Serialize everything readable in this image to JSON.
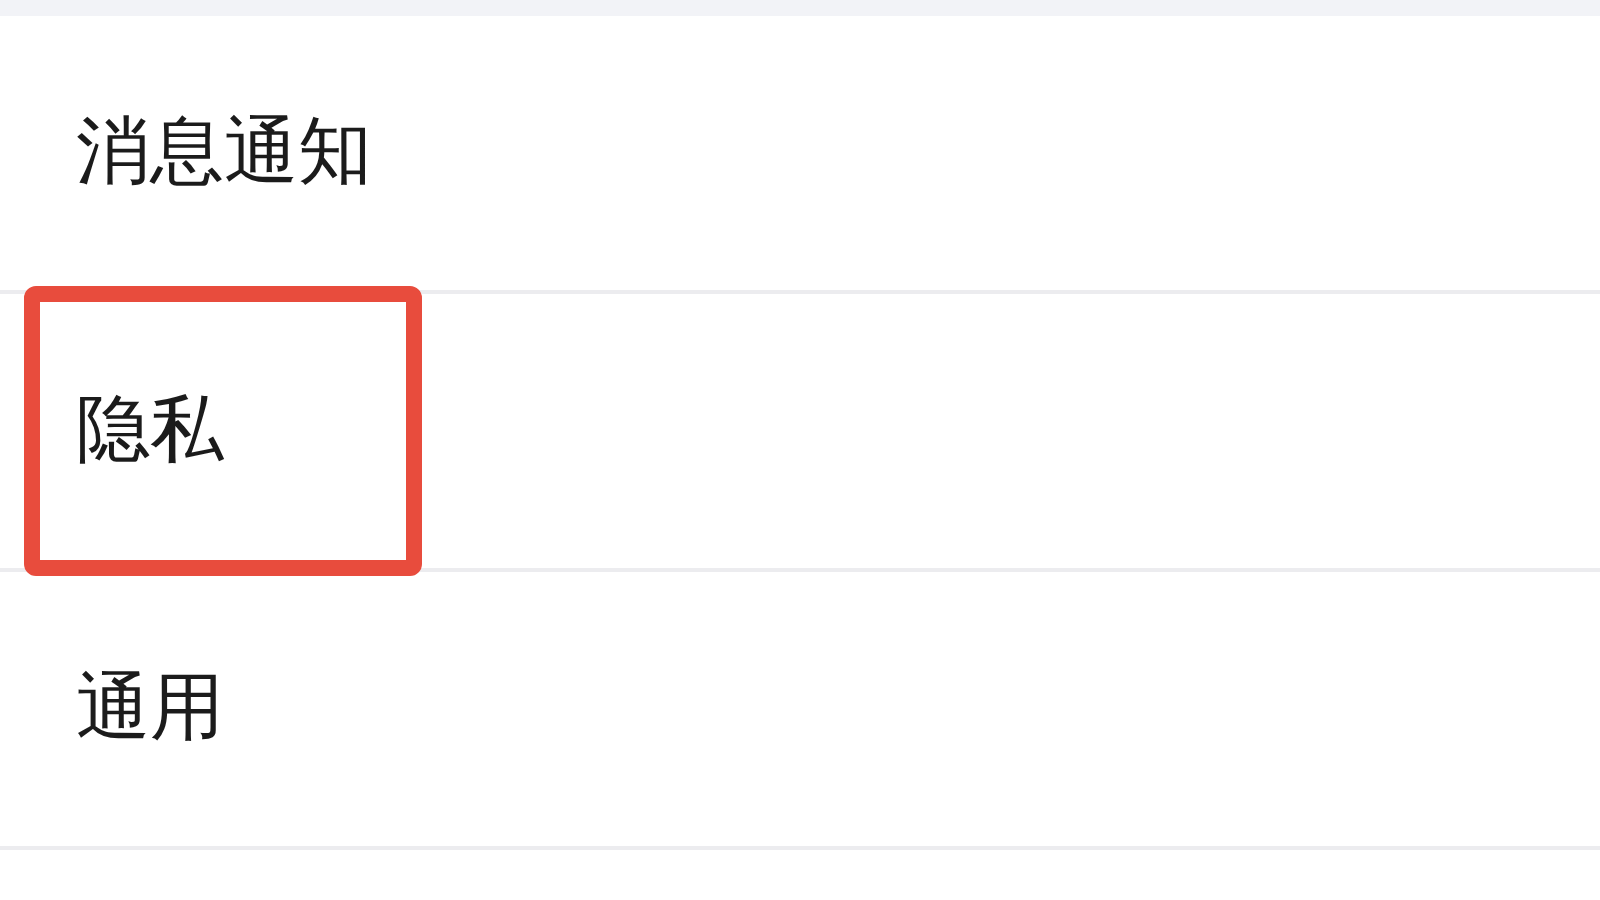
{
  "settings_items": [
    {
      "label": "消息通知",
      "highlighted": false
    },
    {
      "label": "隐私",
      "highlighted": true
    },
    {
      "label": "通用",
      "highlighted": false
    }
  ]
}
